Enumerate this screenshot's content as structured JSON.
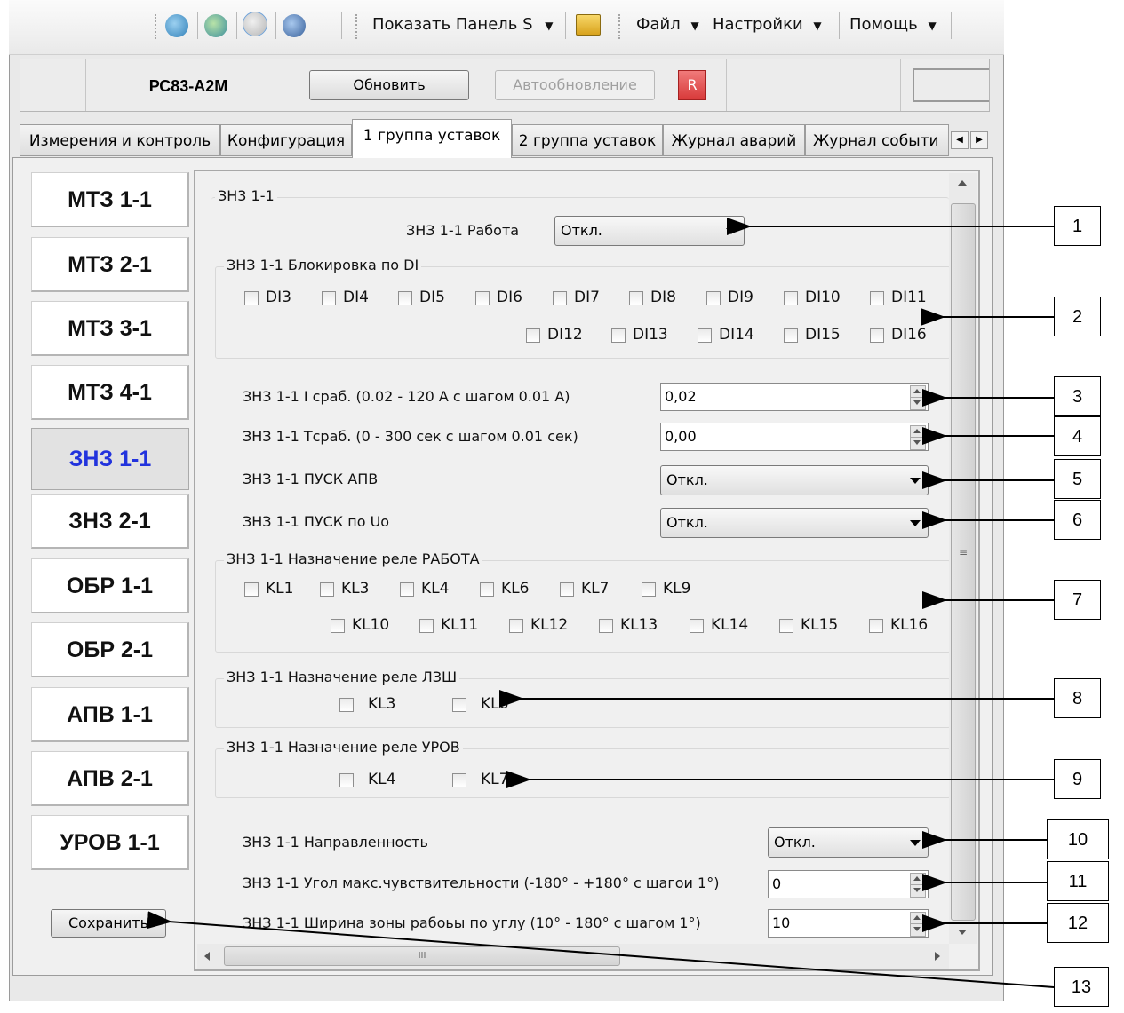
{
  "toolbar": {
    "icons": [
      "globe-icon",
      "globe-search-icon",
      "globe-gray-icon",
      "globe-user-icon"
    ],
    "show_panel_label": "Показать Панель S",
    "menu_file": "Файл",
    "menu_settings": "Настройки",
    "menu_help": "Помощь"
  },
  "device": {
    "name": "РС83-А2М",
    "refresh_label": "Обновить",
    "autorefresh_label": "Автообновление",
    "r_label": "R"
  },
  "tabs": [
    {
      "label": "Измерения и контроль"
    },
    {
      "label": "Конфигурация"
    },
    {
      "label": "1 группа уставок"
    },
    {
      "label": "2 группа уставок"
    },
    {
      "label": "Журнал аварий"
    },
    {
      "label": "Журнал событи"
    }
  ],
  "nav": {
    "items": [
      "МТЗ 1-1",
      "МТЗ 2-1",
      "МТЗ 3-1",
      "МТЗ 4-1",
      "ЗНЗ 1-1",
      "ЗНЗ 2-1",
      "ОБР 1-1",
      "ОБР 2-1",
      "АПВ 1-1",
      "АПВ 2-1",
      "УРОВ 1-1"
    ],
    "active": "ЗНЗ 1-1",
    "save_label": "Сохранить"
  },
  "panel": {
    "group_title": "ЗН3 1-1",
    "work_label": "ЗНЗ 1-1 Работа",
    "work_value": "Откл.",
    "di_group_title": "ЗНЗ 1-1 Блокировка по DI",
    "di_items": [
      "DI3",
      "DI4",
      "DI5",
      "DI6",
      "DI7",
      "DI8",
      "DI9",
      "DI10",
      "DI11",
      "DI12",
      "DI13",
      "DI14",
      "DI15",
      "DI16"
    ],
    "i_label": "ЗНЗ 1-1 I сраб.  (0.02 - 120 А с шагом 0.01 А)",
    "i_value": "0,02",
    "t_label": "ЗНЗ 1-1 Тсраб.  (0 - 300 сек с шагом 0.01 сек)",
    "t_value": "0,00",
    "apv_label": "ЗНЗ 1-1 ПУСК АПВ",
    "apv_value": "Откл.",
    "uo_label": "ЗНЗ 1-1 ПУСК по Uo",
    "uo_value": "Откл.",
    "relay_work_title": "ЗНЗ 1-1 Назначение реле РАБОТА",
    "relay_work_items": [
      "KL1",
      "KL3",
      "KL4",
      "KL6",
      "KL7",
      "KL9",
      "KL10",
      "KL11",
      "KL12",
      "KL13",
      "KL14",
      "KL15",
      "KL16"
    ],
    "relay_lzsh_title": "ЗНЗ 1-1 Назначение реле ЛЗШ",
    "relay_lzsh_items": [
      "KL3",
      "KL6"
    ],
    "relay_urov_title": "ЗНЗ 1-1 Назначение реле УРОВ",
    "relay_urov_items": [
      "KL4",
      "KL7"
    ],
    "dir_label": "ЗНЗ 1-1 Направленность",
    "dir_value": "Откл.",
    "angle_label": "ЗНЗ 1-1 Угол макс.чувствительности  (-180° - +180°  с шагои 1°)",
    "angle_value": "0",
    "width_label": "ЗНЗ 1-1 Ширина зоны рабоьы по углу  (10° - 180° с шагом 1°)",
    "width_value": "10"
  },
  "scroll": {
    "h_thumb_label": "III"
  },
  "callouts": [
    "1",
    "2",
    "3",
    "4",
    "5",
    "6",
    "7",
    "8",
    "9",
    "10",
    "11",
    "12",
    "13"
  ]
}
